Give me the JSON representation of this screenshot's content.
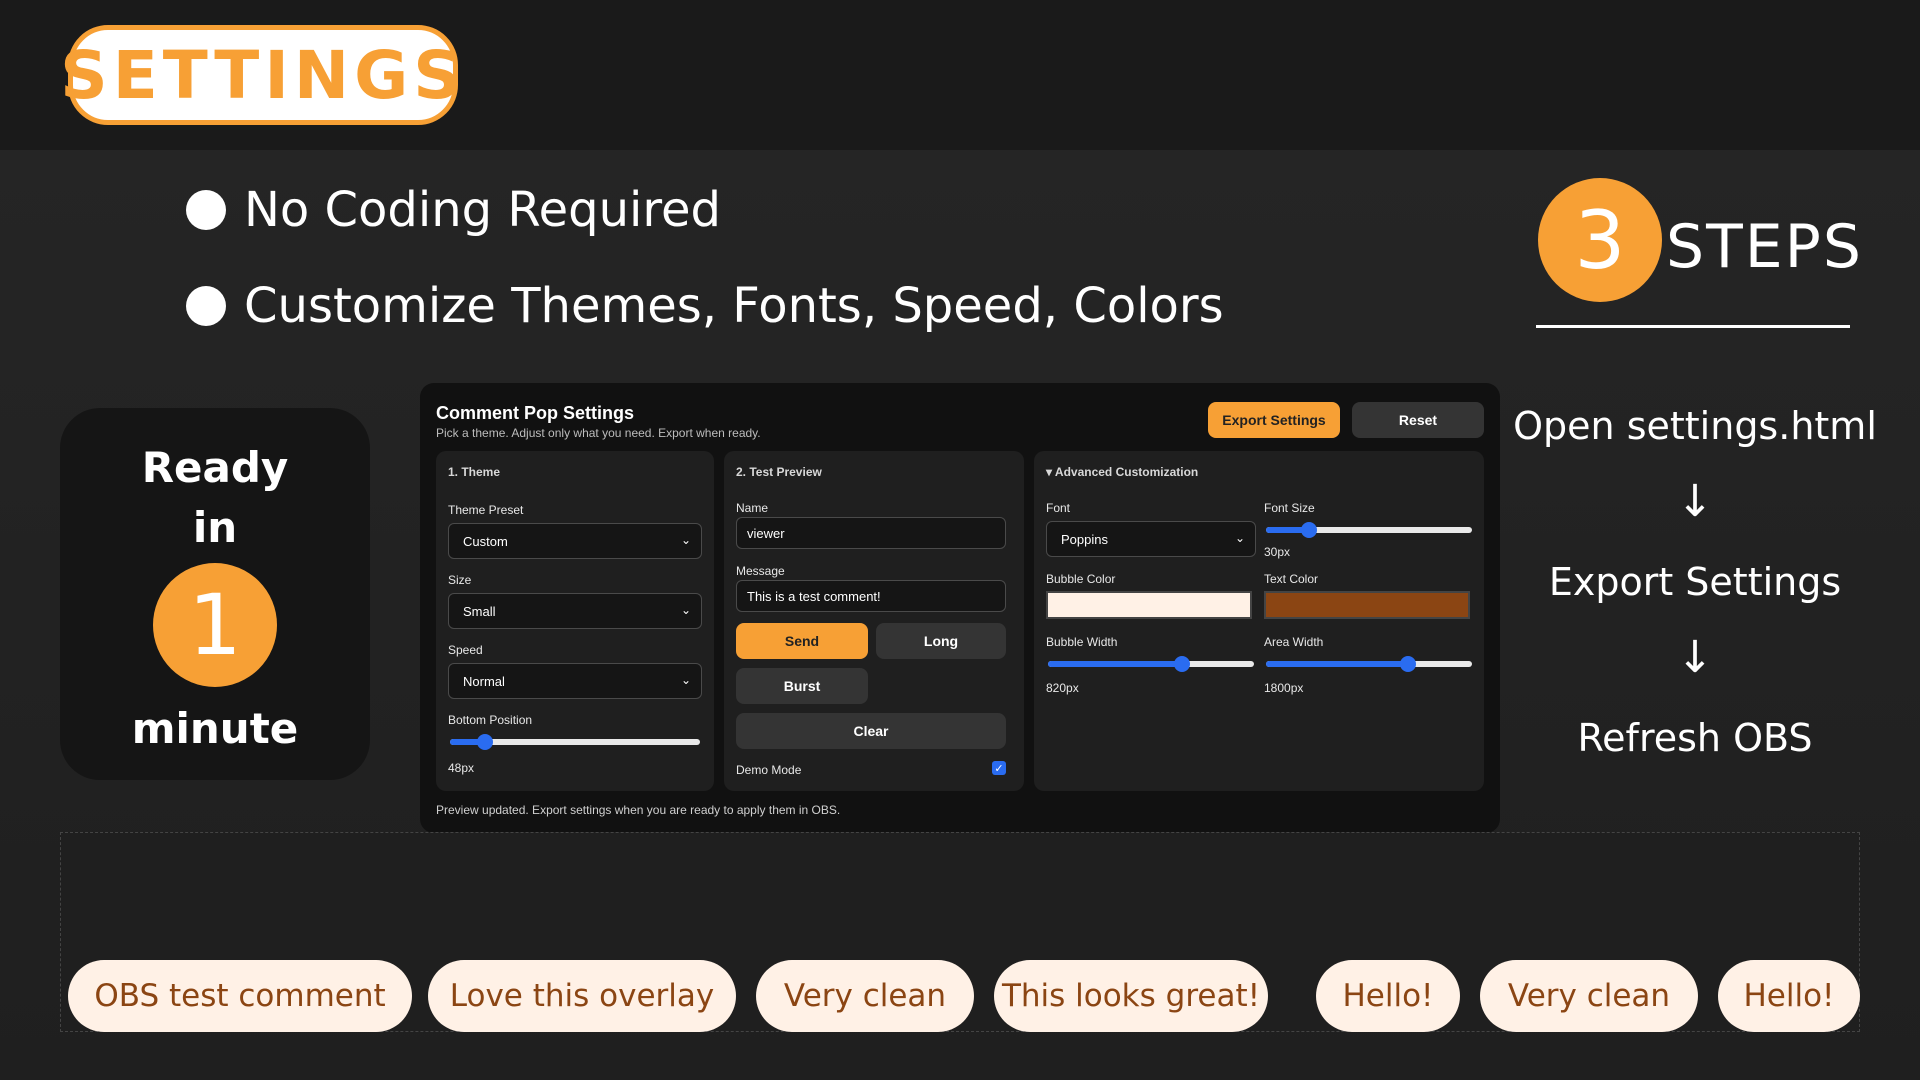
{
  "header": {
    "title": "SETTINGS"
  },
  "bullets": [
    "No Coding Required",
    "Customize Themes, Fonts, Speed, Colors"
  ],
  "steps": {
    "number": "3",
    "word": "STEPS",
    "flow": [
      "Open settings.html",
      "Export Settings",
      "Refresh OBS"
    ],
    "arrow": "↓"
  },
  "ready": {
    "line1": "Ready",
    "line2": "in",
    "number": "1",
    "line3": "minute"
  },
  "panel": {
    "title": "Comment Pop Settings",
    "subtitle": "Pick a theme. Adjust only what you need. Export when ready.",
    "export_label": "Export Settings",
    "reset_label": "Reset",
    "theme": {
      "heading": "1. Theme",
      "preset_label": "Theme Preset",
      "preset_value": "Custom",
      "size_label": "Size",
      "size_value": "Small",
      "speed_label": "Speed",
      "speed_value": "Normal",
      "bottom_label": "Bottom Position",
      "bottom_value": "48px",
      "bottom_fraction": 0.14
    },
    "preview": {
      "heading": "2. Test Preview",
      "name_label": "Name",
      "name_value": "viewer",
      "message_label": "Message",
      "message_value": "This is a test comment!",
      "send_label": "Send",
      "long_label": "Long",
      "burst_label": "Burst",
      "clear_label": "Clear",
      "demo_label": "Demo Mode",
      "demo_checked": true
    },
    "advanced": {
      "heading": "▾ Advanced Customization",
      "font_label": "Font",
      "font_value": "Poppins",
      "fontsize_label": "Font Size",
      "fontsize_value": "30px",
      "fontsize_fraction": 0.21,
      "bubble_color_label": "Bubble Color",
      "bubble_color": "#fff1e6",
      "text_color_label": "Text Color",
      "text_color": "#8b4513",
      "bubble_width_label": "Bubble Width",
      "bubble_width_value": "820px",
      "bubble_width_fraction": 0.65,
      "area_width_label": "Area Width",
      "area_width_value": "1800px",
      "area_width_fraction": 0.69
    },
    "footer": "Preview updated. Export settings when you are ready to apply them in OBS."
  },
  "bubbles": [
    "OBS test comment",
    "Love this overlay",
    "Very clean",
    "This looks great!",
    "Hello!",
    "Very clean",
    "Hello!"
  ],
  "colors": {
    "accent": "#f7a035",
    "slider": "#2a6cf0"
  }
}
